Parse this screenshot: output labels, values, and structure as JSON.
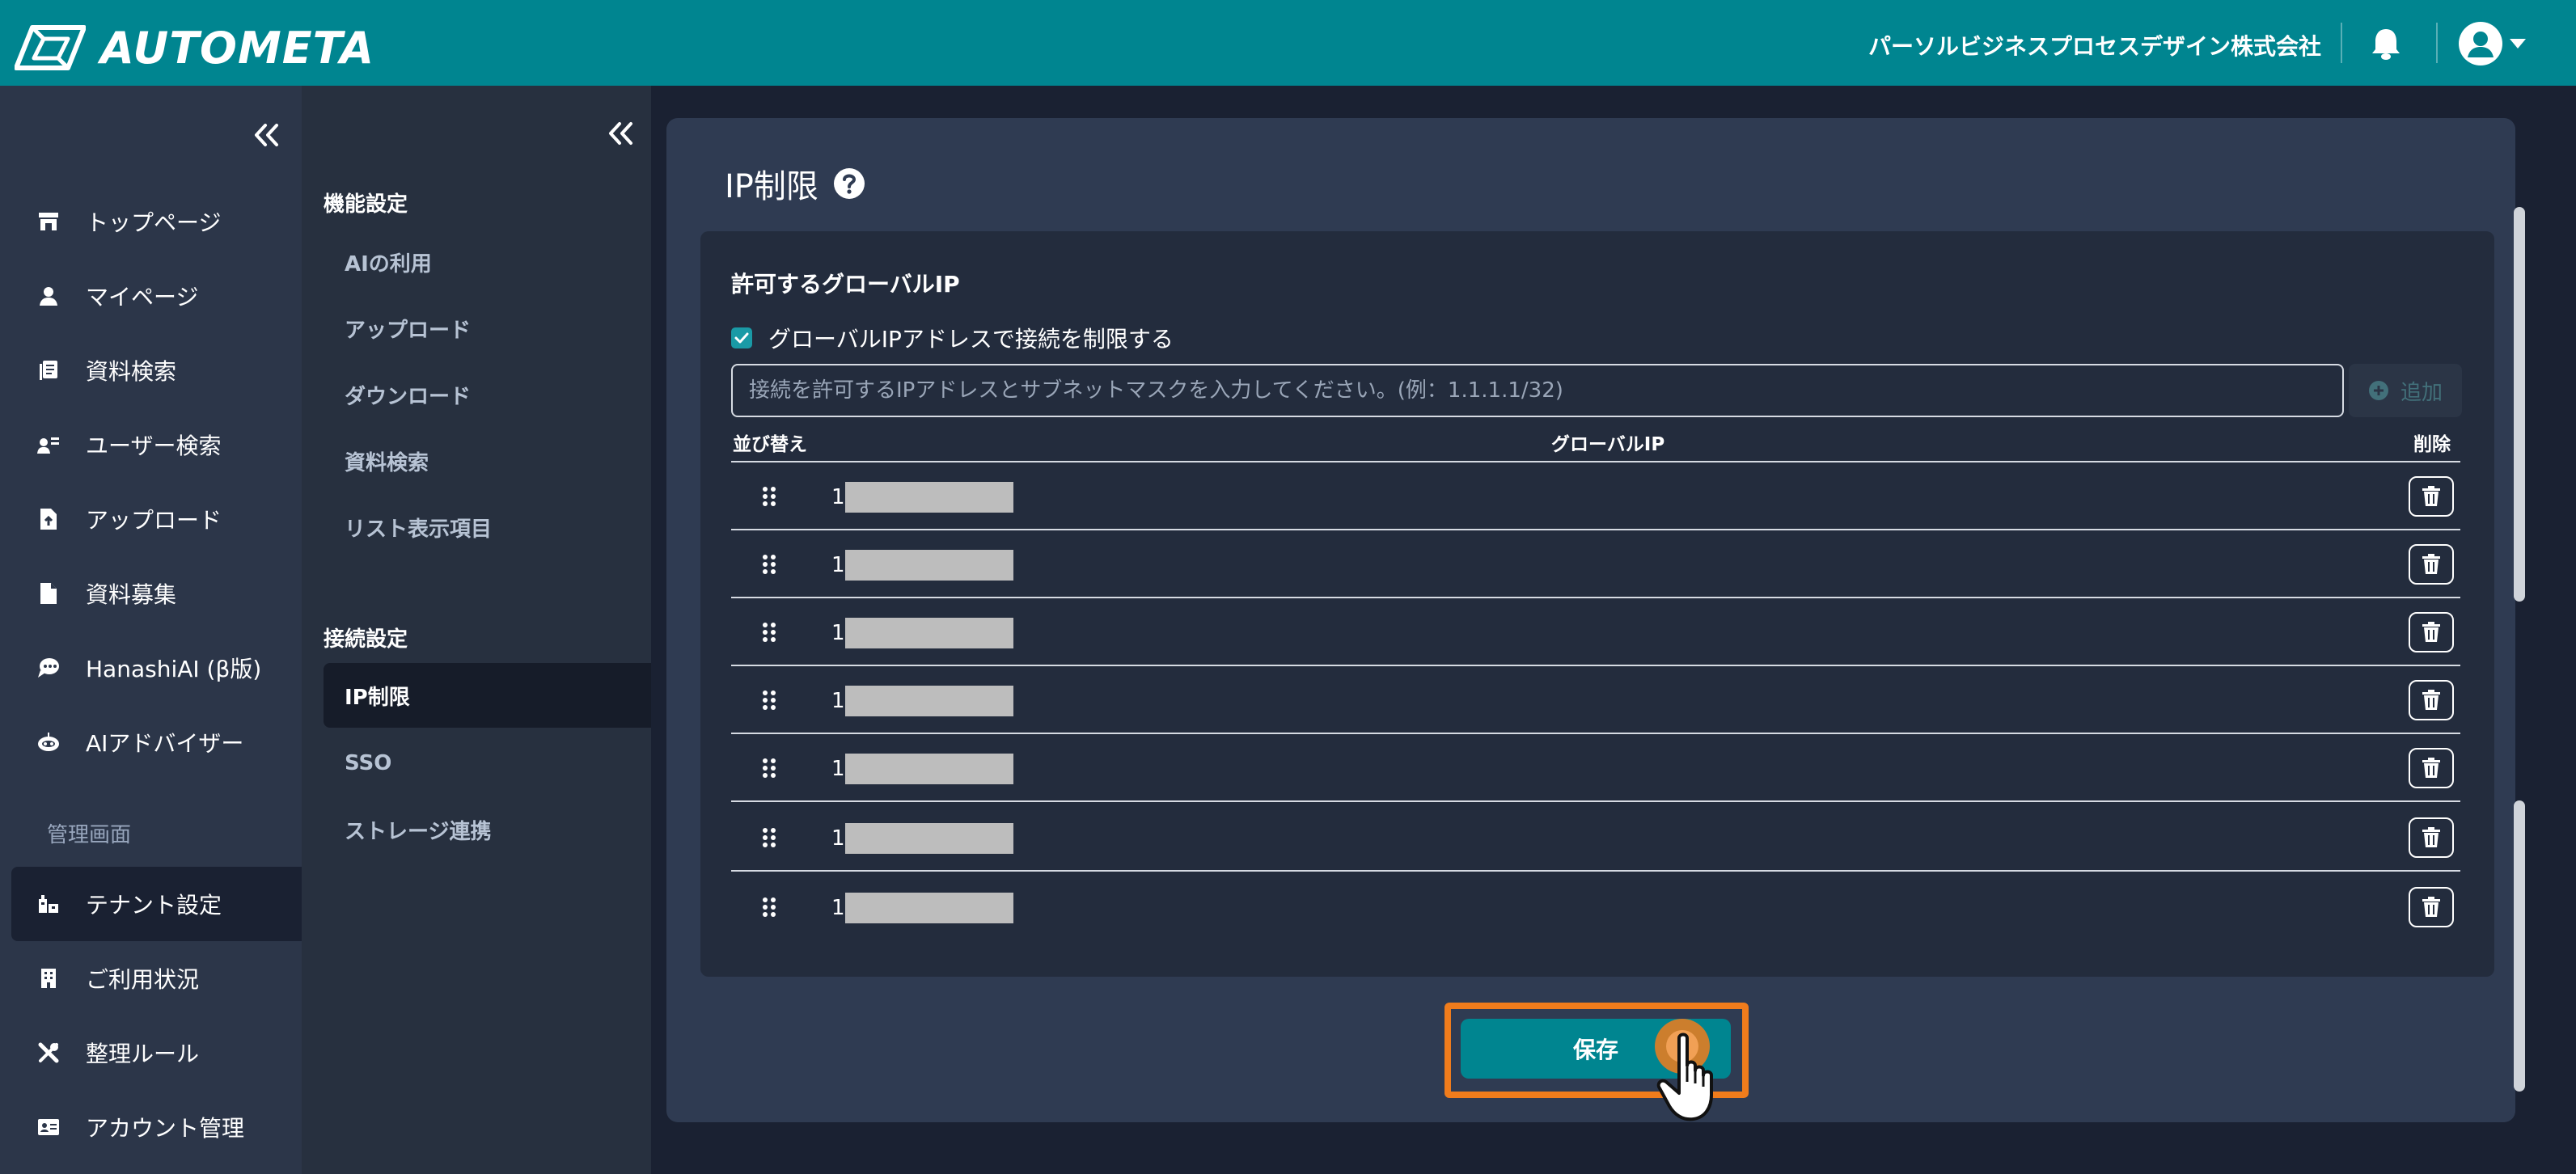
{
  "header": {
    "brand": "AUTOMETA",
    "company": "パーソルビジネスプロセスデザイン株式会社",
    "color": "#008590"
  },
  "sidebar": {
    "items": [
      {
        "label": "トップページ",
        "icon": "store-icon"
      },
      {
        "label": "マイページ",
        "icon": "person-icon"
      },
      {
        "label": "資料検索",
        "icon": "document-search-icon"
      },
      {
        "label": "ユーザー検索",
        "icon": "user-search-icon"
      },
      {
        "label": "アップロード",
        "icon": "file-upload-icon"
      },
      {
        "label": "資料募集",
        "icon": "file-icon"
      },
      {
        "label": "HanashiAI (β版)",
        "icon": "chat-bubble-icon"
      },
      {
        "label": "AIアドバイザー",
        "icon": "robot-icon"
      }
    ],
    "section_label": "管理画面",
    "admin_items": [
      {
        "label": "テナント設定",
        "icon": "tenant-icon",
        "active": true
      },
      {
        "label": "ご利用状況",
        "icon": "building-icon"
      },
      {
        "label": "整理ルール",
        "icon": "tools-icon"
      },
      {
        "label": "アカウント管理",
        "icon": "id-card-icon"
      }
    ]
  },
  "subnav": {
    "section1": "機能設定",
    "items1": [
      "AIの利用",
      "アップロード",
      "ダウンロード",
      "資料検索",
      "リスト表示項目"
    ],
    "section2": "接続設定",
    "items2": [
      "IP制限",
      "SSO",
      "ストレージ連携"
    ],
    "active": "IP制限"
  },
  "main": {
    "title": "IP制限",
    "section_title": "許可するグローバルIP",
    "checkbox_label": "グローバルIPアドレスで接続を制限する",
    "checkbox_checked": true,
    "input_placeholder": "接続を許可するIPアドレスとサブネットマスクを入力してください。(例：1.1.1.1/32)",
    "add_label": "追加",
    "table": {
      "col_sort": "並び替え",
      "col_ip": "グローバルIP",
      "col_delete": "削除",
      "rows": [
        {
          "ip_visible": "1"
        },
        {
          "ip_visible": "1"
        },
        {
          "ip_visible": "1"
        },
        {
          "ip_visible": "1"
        },
        {
          "ip_visible": "1"
        },
        {
          "ip_visible": "1"
        },
        {
          "ip_visible": "1"
        }
      ]
    },
    "save_label": "保存",
    "highlight_color": "#f07c1c"
  }
}
